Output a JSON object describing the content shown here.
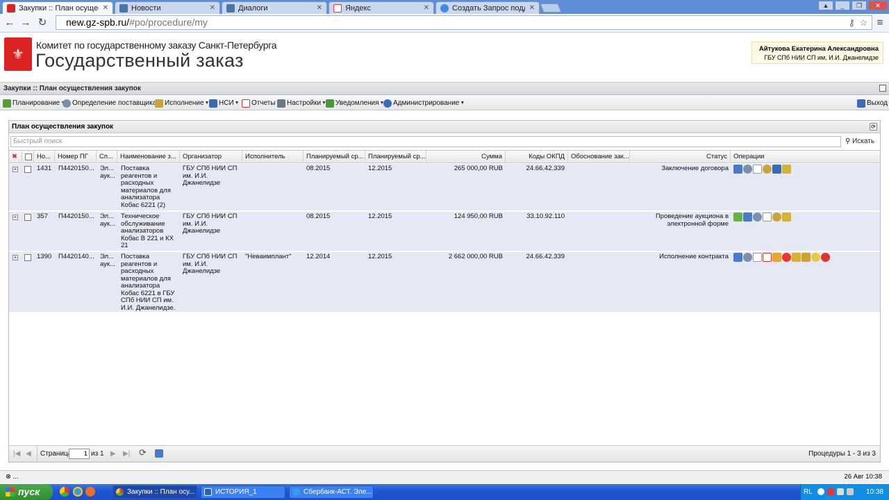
{
  "browser": {
    "tabs": [
      {
        "label": "Закупки :: План осуществле",
        "active": true
      },
      {
        "label": "Новости",
        "active": false
      },
      {
        "label": "Диалоги",
        "active": false
      },
      {
        "label": "Яндекс",
        "active": false
      },
      {
        "label": "Создать Запрос поддержки",
        "active": false
      }
    ],
    "url_host": "new.gz-spb.ru/",
    "url_path": "#po/procedure/my"
  },
  "header": {
    "org_line": "Комитет по государственному заказу Санкт-Петербурга",
    "title": "Государственный заказ",
    "user_name": "Айтукова Екатерина Александровна",
    "user_org": "ГБУ СПб НИИ СП им. И.И. Джанелидзе"
  },
  "breadcrumb": "Закупки :: План осуществления закупок",
  "menu": {
    "items": [
      "Планирование",
      "Определение поставщика",
      "Исполнение",
      "НСИ",
      "Отчеты",
      "Настройки",
      "Уведомления",
      "Администрирование"
    ],
    "exit": "Выход"
  },
  "panel": {
    "title": "План осуществления закупок",
    "search_placeholder": "Быстрый поиск",
    "search_button": "Искать"
  },
  "grid": {
    "columns": [
      "Но...",
      "Номер ПГ",
      "Сп...",
      "Наименование з...",
      "Организатор",
      "Исполнитель",
      "Планируемый ср...",
      "Планируемый ср...",
      "Сумма",
      "Коды ОКПД",
      "Обоснование зак...",
      "Статус",
      "Операции"
    ],
    "rows": [
      {
        "no": "1431",
        "pg": "П4420150...",
        "sp": "Эл... аук...",
        "name": "Поставка реагентов и расходных материалов для анализатора Кобас 6221 (2)",
        "org": "ГБУ СПб НИИ СП им. И.И. Джанелидзе",
        "exec": "",
        "d1": "08.2015",
        "d2": "12.2015",
        "sum": "265 000,00 RUB",
        "okpd": "24.66.42.339",
        "reason": "",
        "status": "Заключение договора"
      },
      {
        "no": "357",
        "pg": "П4420150...",
        "sp": "Эл... аук...",
        "name": "Техническое обслуживание анализаторов Кобас В 221 и КХ 21",
        "org": "ГБУ СПб НИИ СП им. И.И. Джанелидзе",
        "exec": "",
        "d1": "08.2015",
        "d2": "12.2015",
        "sum": "124 950,00 RUB",
        "okpd": "33.10.92.110",
        "reason": "",
        "status": "Проведение аукциона в электронной форме"
      },
      {
        "no": "1390",
        "pg": "П4420140...",
        "sp": "Эл... аук...",
        "name": "Поставка реагентов и расходных материалов для анализатора Кобас 6221 в ГБУ СПб НИИ СП им. И.И. Джанелидзе.",
        "org": "ГБУ СПб НИИ СП им. И.И. Джанелидзе",
        "exec": "\"Неваимплант\"",
        "d1": "12.2014",
        "d2": "12.2015",
        "sum": "2 662 000,00 RUB",
        "okpd": "24.66.42.339",
        "reason": "",
        "status": "Исполнение контракта"
      }
    ]
  },
  "pager": {
    "page_label": "Страница",
    "page_value": "1",
    "of_label": "из 1",
    "summary": "Процедуры 1 - 3 из 3"
  },
  "statusbar": {
    "left": "⊗ ...",
    "right": "26 Авг 10:38"
  },
  "taskbar": {
    "start": "пуск",
    "windows": [
      "Закупки :: План осу...",
      "ИСТОРИЯ_1",
      "Сбербанк-АСТ. Эле..."
    ],
    "lang": "RL",
    "clock": "10:38"
  }
}
